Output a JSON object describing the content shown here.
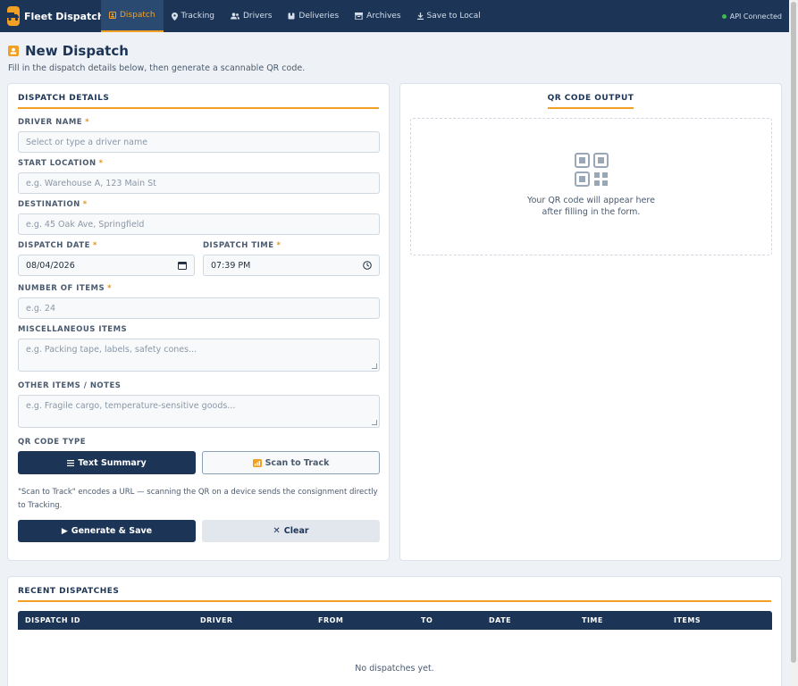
{
  "app": {
    "name": "Fleet Dispatch"
  },
  "nav": {
    "items": [
      {
        "label": "Dispatch",
        "icon": "badge-icon",
        "active": true
      },
      {
        "label": "Tracking",
        "icon": "map-pin-icon"
      },
      {
        "label": "Drivers",
        "icon": "users-icon"
      },
      {
        "label": "Deliveries",
        "icon": "package-icon"
      },
      {
        "label": "Archives",
        "icon": "archive-icon"
      },
      {
        "label": "Save to Local",
        "icon": "download-icon"
      }
    ]
  },
  "api_status": {
    "label": "API Connected",
    "color": "#3fb950"
  },
  "page": {
    "title": "New Dispatch",
    "subtitle": "Fill in the dispatch details below, then generate a scannable QR code."
  },
  "form": {
    "title": "DISPATCH DETAILS",
    "required_mark": "*",
    "driver": {
      "label": "DRIVER NAME",
      "placeholder": "Select or type a driver name"
    },
    "start": {
      "label": "START LOCATION",
      "placeholder": "e.g. Warehouse A, 123 Main St"
    },
    "destination": {
      "label": "DESTINATION",
      "placeholder": "e.g. 45 Oak Ave, Springfield"
    },
    "date": {
      "label": "DISPATCH DATE",
      "value": "08/04/2026"
    },
    "time": {
      "label": "DISPATCH TIME",
      "value": "07:39 PM"
    },
    "items": {
      "label": "NUMBER OF ITEMS",
      "placeholder": "e.g. 24"
    },
    "misc": {
      "label": "MISCELLANEOUS ITEMS",
      "placeholder": "e.g. Packing tape, labels, safety cones..."
    },
    "notes": {
      "label": "OTHER ITEMS / NOTES",
      "placeholder": "e.g. Fragile cargo, temperature-sensitive goods..."
    },
    "qr_type": {
      "label": "QR CODE TYPE",
      "text_summary": "Text Summary",
      "scan_to_track": "Scan to Track",
      "selected": "Text Summary"
    },
    "hint": "\"Scan to Track\" encodes a URL — scanning the QR on a device sends the consignment directly to Tracking.",
    "generate_label": "Generate & Save",
    "clear_label": "Clear"
  },
  "qr": {
    "title": "QR CODE OUTPUT",
    "placeholder_line1": "Your QR code will appear here",
    "placeholder_line2": "after filling in the form."
  },
  "recent": {
    "title": "RECENT DISPATCHES",
    "columns": [
      "DISPATCH ID",
      "DRIVER",
      "FROM",
      "TO",
      "DATE",
      "TIME",
      "ITEMS"
    ],
    "rows": [],
    "empty_text": "No dispatches yet."
  },
  "colors": {
    "navy": "#1c3557",
    "accent": "#f2a024",
    "background": "#eef1f5"
  }
}
